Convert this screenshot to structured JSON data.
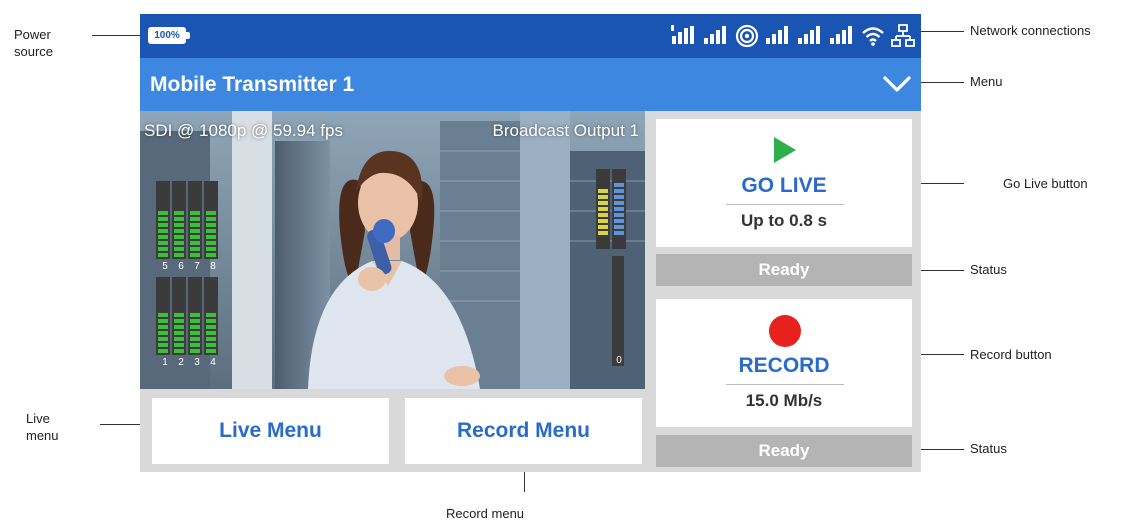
{
  "statusbar": {
    "battery": "100%",
    "icons": [
      "signal-1-icon",
      "signal-2-icon",
      "target-icon",
      "signal-3-icon",
      "signal-4-icon",
      "signal-5-icon",
      "wifi-icon",
      "network-icon"
    ]
  },
  "titlebar": {
    "title": "Mobile Transmitter 1",
    "menu_icon": "chevron-down-icon"
  },
  "video": {
    "format": "SDI @ 1080p @ 59.94 fps",
    "output": "Broadcast Output 1",
    "meter_labels_top": [
      "5",
      "6",
      "7",
      "8"
    ],
    "meter_labels_bottom": [
      "1",
      "2",
      "3",
      "4"
    ],
    "right_meter_label": "0"
  },
  "go_live": {
    "title": "GO LIVE",
    "subtitle": "Up to 0.8 s",
    "status": "Ready",
    "icon": "play-icon"
  },
  "record": {
    "title": "RECORD",
    "subtitle": "15.0 Mb/s",
    "status": "Ready",
    "icon": "record-dot-icon"
  },
  "menus": {
    "live": "Live Menu",
    "record": "Record Menu"
  },
  "annotations": {
    "power": "Power source",
    "network": "Network connections",
    "menu": "Menu",
    "go_live_button": "Go Live button",
    "status_1": "Status",
    "record_button": "Record button",
    "status_2": "Status",
    "live_menu": "Live menu",
    "record_menu": "Record menu"
  },
  "colors": {
    "statusbar": "#1b55b3",
    "titlebar": "#3e87e0",
    "accent_text": "#2a6bc9",
    "play_green": "#2db04b",
    "record_red": "#e8201e",
    "status_grey": "#b4b4b4"
  }
}
